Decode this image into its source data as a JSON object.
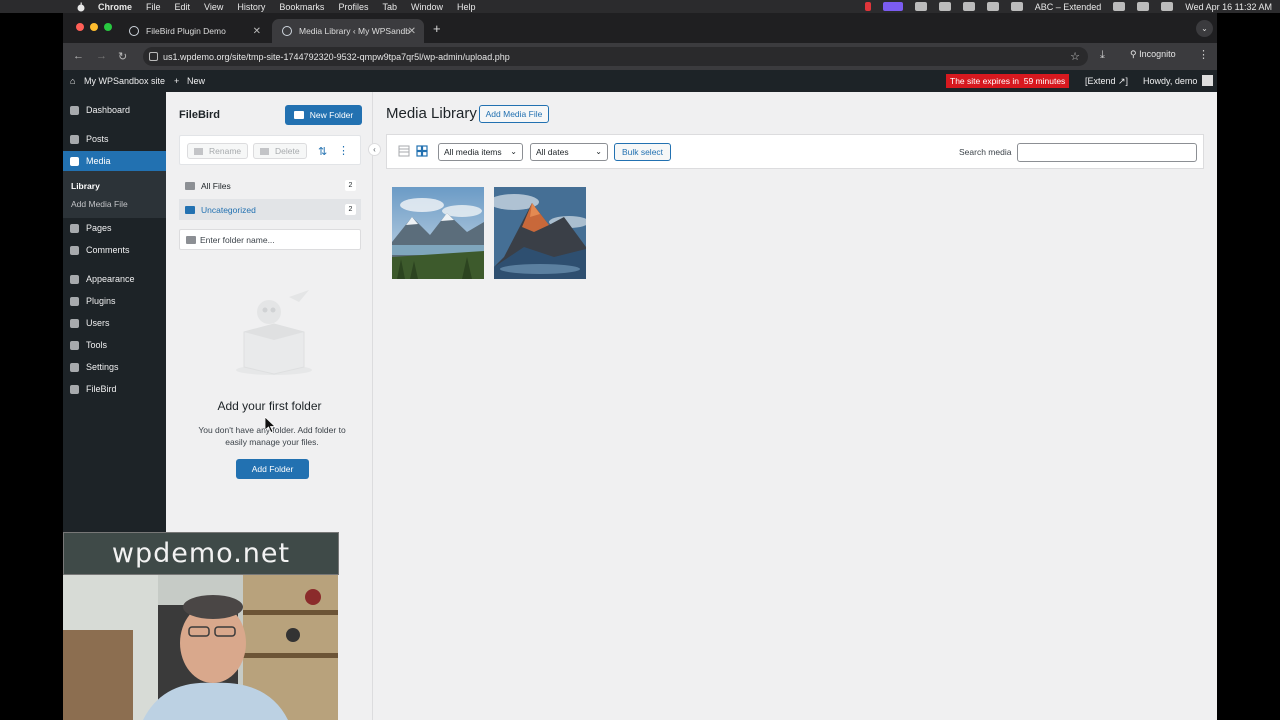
{
  "mac_menu": {
    "app": "Chrome",
    "items": [
      "File",
      "Edit",
      "View",
      "History",
      "Bookmarks",
      "Profiles",
      "Tab",
      "Window",
      "Help"
    ],
    "input_source": "ABC – Extended",
    "clock": "Wed Apr 16  11:32 AM"
  },
  "browser": {
    "tabs": [
      {
        "title": "FileBird Plugin Demo"
      },
      {
        "title": "Media Library ‹ My WPSandb"
      }
    ],
    "url": "us1.wpdemo.org/site/tmp-site-1744792320-9532-qmpw9tpa7qr5l/wp-admin/upload.php",
    "profile": "Incognito"
  },
  "adminbar": {
    "site": "My WPSandbox site",
    "new": "New",
    "expires_prefix": "The site expires in",
    "expires_value": "59 minutes",
    "extend": "[Extend ↗]",
    "howdy": "Howdy, demo"
  },
  "sidebar": {
    "items": [
      {
        "label": "Dashboard"
      },
      {
        "label": "Posts"
      },
      {
        "label": "Media"
      },
      {
        "label": "Pages"
      },
      {
        "label": "Comments"
      },
      {
        "label": "Appearance"
      },
      {
        "label": "Plugins"
      },
      {
        "label": "Users"
      },
      {
        "label": "Tools"
      },
      {
        "label": "Settings"
      },
      {
        "label": "FileBird"
      }
    ],
    "submenu": [
      "Library",
      "Add Media File"
    ]
  },
  "filebird": {
    "title": "FileBird",
    "new_folder": "New Folder",
    "rename": "Rename",
    "delete": "Delete",
    "folders": [
      {
        "label": "All Files",
        "count": "2"
      },
      {
        "label": "Uncategorized",
        "count": "2"
      }
    ],
    "folder_placeholder": "Enter folder name...",
    "empty_title": "Add your first folder",
    "empty_desc": "You don't have any folder. Add folder to easily manage your files.",
    "add_folder": "Add Folder"
  },
  "media": {
    "title": "Media Library",
    "add_button": "Add Media File",
    "filter_type": "All media items",
    "filter_date": "All dates",
    "bulk_select": "Bulk select",
    "search_label": "Search media",
    "search_value": ""
  },
  "overlay": {
    "watermark": "wpdemo.net"
  }
}
